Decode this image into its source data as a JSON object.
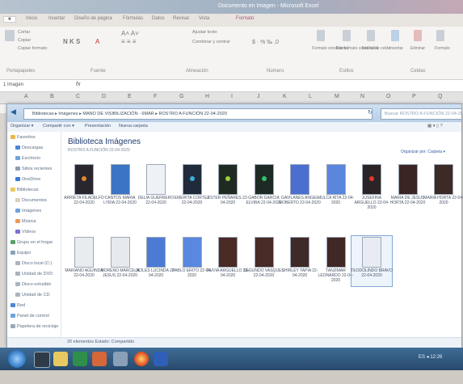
{
  "excel": {
    "title": "Documento en Imagen - Microsoft Excel",
    "tabs": [
      "Inicio",
      "Insertar",
      "Diseño de página",
      "Fórmulas",
      "Datos",
      "Revisar",
      "Vista",
      "Formato"
    ],
    "ribbon_groups": [
      "Portapapeles",
      "Fuente",
      "Alineación",
      "Número",
      "Estilos",
      "Celdas"
    ],
    "buttons": {
      "cortar": "Cortar",
      "copiar": "Copiar",
      "copiar_formato": "Copiar formato",
      "ajustar_texto": "Ajustar texto",
      "combinar": "Combinar y centrar",
      "formato_condicional": "Formato condicional",
      "dar_formato": "Dar formato como tabla",
      "estilos_celda": "Estilos de celda",
      "insertar": "Insertar",
      "eliminar": "Eliminar",
      "formato": "Formato"
    },
    "name_box": "1 Imagen",
    "fx": "fx",
    "columns": [
      "A",
      "B",
      "C",
      "D",
      "E",
      "F",
      "G",
      "H",
      "I",
      "J",
      "K",
      "L",
      "M",
      "N",
      "O",
      "P",
      "Q"
    ]
  },
  "explorer": {
    "path": "Bibliotecas ▸ Imágenes ▸ MANO DE VISIBILIZACIÓN - 6MAR ▸ ROSTRO A FUNCIÓN 22-04-2020",
    "search_placeholder": "Buscar ROSTRO A FUNCIÓN 22-04-2020",
    "commands": [
      "Organizar ▾",
      "Compartir con ▾",
      "Presentación",
      "Nueva carpeta"
    ],
    "nav": [
      "Favoritos",
      "Descargas",
      "Escritorio",
      "Sitios recientes",
      "OneDrive",
      "Bibliotecas",
      "Documentos",
      "Imágenes",
      "Música",
      "Vídeos",
      "Grupo en el hogar",
      "Equipo",
      "Disco local (C:)",
      "Unidad de DVD",
      "Disco extraíble",
      "Unidad de CD",
      "Red",
      "Panel de control",
      "Papelera de reciclaje"
    ],
    "library_title": "Biblioteca Imágenes",
    "library_sub": "ROSTRO A FUNCIÓN 22-04-2020",
    "arrange": "Organizar por: Carpeta ▾",
    "files_row1": [
      {
        "name": "ARRIETA FILADELFO 22-04-2020",
        "bg": "#2a2630",
        "dot": "#e08a2a"
      },
      {
        "name": "CANTOS MARIA LYRIA 22-04-2020",
        "bg": "#3c74c4",
        "dot": ""
      },
      {
        "name": "DELIA GUERRERO 22-04-2020",
        "bg": "#eef1f6",
        "dot": ""
      },
      {
        "name": "EMERITA CORTEZ 22-04-2020",
        "bg": "#1f2b3a",
        "dot": "#3ab0d8"
      },
      {
        "name": "ESTER PEÑARES 22-04-2020",
        "bg": "#1f2a22",
        "dot": "#9ad23a"
      },
      {
        "name": "GABOR GARCIA ELVIRA 22-04-2020",
        "bg": "#1e2a26",
        "dot": "#34c06a"
      },
      {
        "name": "GAVILANES ANGEL ROBERTO 22-04-2020",
        "bg": "#4a6fd0",
        "dot": ""
      },
      {
        "name": "MULCA RITA 22-04-2020",
        "bg": "#5a86de",
        "dot": ""
      },
      {
        "name": "JUSEFINA ARGUELLO 22-04-2020",
        "bg": "#2a2426",
        "dot": "#e23a2a"
      },
      {
        "name": "MARIA DE JESUS HORTA 22-04-2020",
        "bg": "#3a2424",
        "dot": ""
      },
      {
        "name": "MARIA HORTA 22-04-2020",
        "bg": "#3c2a26",
        "dot": ""
      }
    ],
    "files_row2": [
      {
        "name": "MARIANO AGUINDA 22-04-2020",
        "bg": "#e9ecef",
        "dot": ""
      },
      {
        "name": "MORENO MARCELA JESUS 22-04-2020",
        "bg": "#e6e9ed",
        "dot": ""
      },
      {
        "name": "NOLES LUCINDA 22-04-2020",
        "bg": "#4c7bd6",
        "dot": ""
      },
      {
        "name": "PABLO ERITO 22-04-2020",
        "bg": "#5a88e0",
        "dot": ""
      },
      {
        "name": "RUVIA ARGUELLO 22-04-2020",
        "bg": "#4a2a24",
        "dot": ""
      },
      {
        "name": "SEGUNDO VASQUES 22-04-2020",
        "bg": "#482a26",
        "dot": ""
      },
      {
        "name": "SHIRLEY TAPIA 22-04-2020",
        "bg": "#3e2a26",
        "dot": ""
      },
      {
        "name": "TANJIMAR LEONARDO 22-04-2020",
        "bg": "#402824",
        "dot": ""
      },
      {
        "name": "TEODOLINDO BRAVO 22-04-2020",
        "bg": "#e8ecf2",
        "dot": "",
        "selected": true
      }
    ],
    "status": "20 elementos   Estado: Compartido"
  },
  "taskbar": {
    "clock": "ES  ◂ 12:26"
  }
}
